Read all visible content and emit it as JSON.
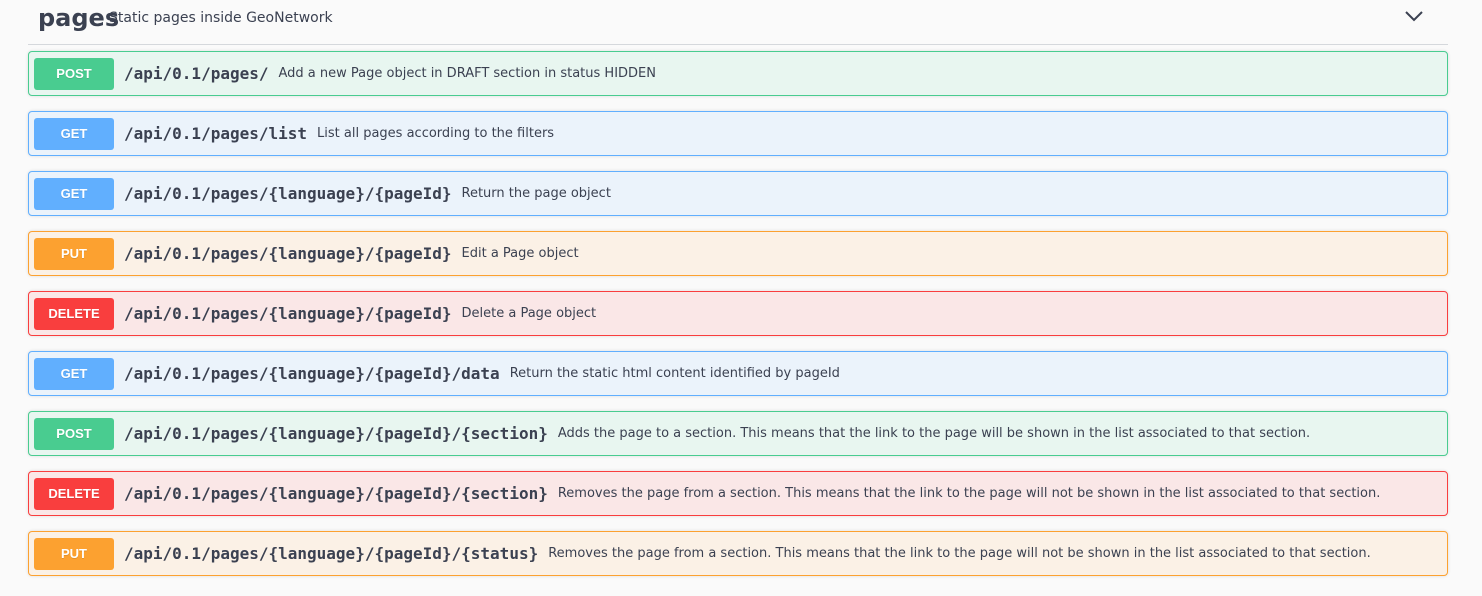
{
  "section": {
    "title": "pages",
    "description": "Static pages inside GeoNetwork",
    "toggle_icon": "chevron-down-icon"
  },
  "operations": [
    {
      "method": "POST",
      "path": "/api/0.1/pages/",
      "summary": "Add a new Page object in DRAFT section in status HIDDEN"
    },
    {
      "method": "GET",
      "path": "/api/0.1/pages/list",
      "summary": "List all pages according to the filters"
    },
    {
      "method": "GET",
      "path": "/api/0.1/pages/{language}/{pageId}",
      "summary": "Return the page object"
    },
    {
      "method": "PUT",
      "path": "/api/0.1/pages/{language}/{pageId}",
      "summary": "Edit a Page object"
    },
    {
      "method": "DELETE",
      "path": "/api/0.1/pages/{language}/{pageId}",
      "summary": "Delete a Page object"
    },
    {
      "method": "GET",
      "path": "/api/0.1/pages/{language}/{pageId}/data",
      "summary": "Return the static html content identified by pageId"
    },
    {
      "method": "POST",
      "path": "/api/0.1/pages/{language}/{pageId}/{section}",
      "summary": "Adds the page to a section. This means that the link to the page will be shown in the list associated to that section."
    },
    {
      "method": "DELETE",
      "path": "/api/0.1/pages/{language}/{pageId}/{section}",
      "summary": "Removes the page from a section. This means that the link to the page will not be shown in the list associated to that section."
    },
    {
      "method": "PUT",
      "path": "/api/0.1/pages/{language}/{pageId}/{status}",
      "summary": "Removes the page from a section. This means that the link to the page will not be shown in the list associated to that section."
    }
  ],
  "colors": {
    "post": "#49cc90",
    "get": "#61affe",
    "put": "#fca130",
    "delete": "#f93e3e"
  }
}
